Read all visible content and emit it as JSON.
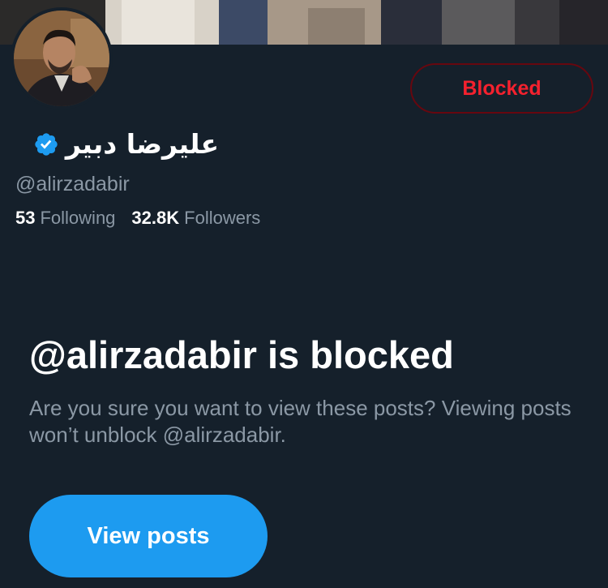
{
  "profile": {
    "display_name": "علیرضا دبیر",
    "handle": "@alirzadabir",
    "verified": true,
    "following_count": "53",
    "following_label": "Following",
    "followers_count": "32.8K",
    "followers_label": "Followers"
  },
  "actions": {
    "blocked_label": "Blocked",
    "view_posts_label": "View posts"
  },
  "blocked_notice": {
    "title": "@alirzadabir is blocked",
    "description": "Are you sure you want to view these posts? Viewing posts won’t unblock @alirzadabir."
  },
  "colors": {
    "background": "#15202b",
    "accent": "#1d9bf0",
    "blocked_red": "#f4212e",
    "secondary_text": "#8b98a5"
  },
  "icons": {
    "verified": "verified-badge-icon"
  }
}
